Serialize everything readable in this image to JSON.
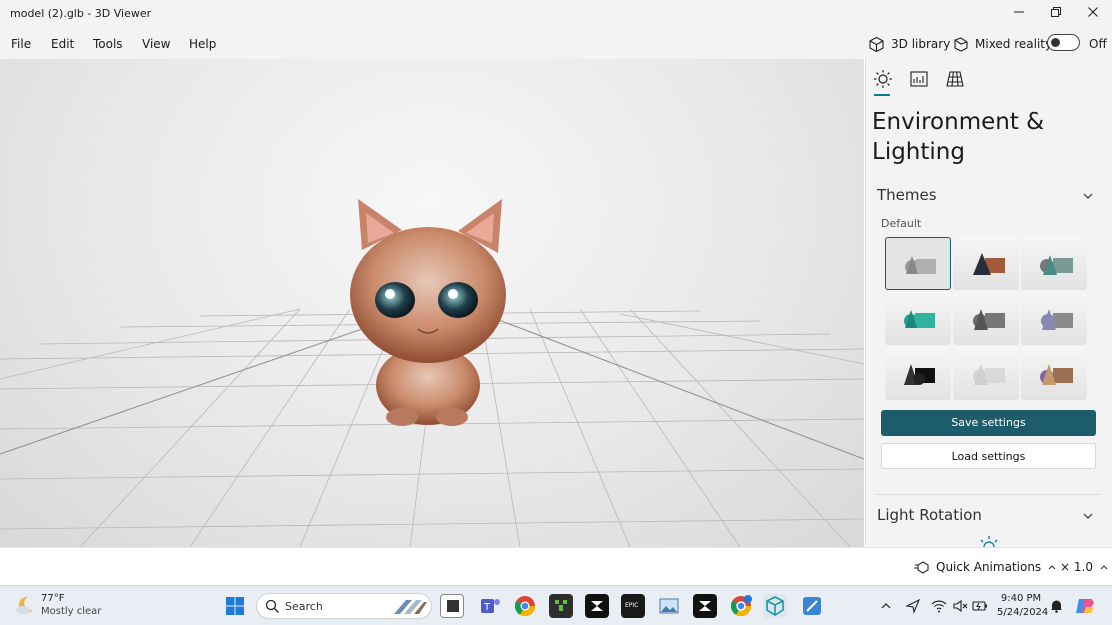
{
  "window": {
    "title": "model (2).glb - 3D Viewer"
  },
  "menu": {
    "file": "File",
    "edit": "Edit",
    "tools": "Tools",
    "view": "View",
    "help": "Help"
  },
  "toolbar": {
    "library": "3D library",
    "mixed_reality": "Mixed reality",
    "toggle_state": "Off"
  },
  "panel": {
    "title": "Environment & Lighting",
    "themes_header": "Themes",
    "default_label": "Default",
    "save_label": "Save settings",
    "load_label": "Load settings",
    "light_rotation": "Light Rotation",
    "accent": "#1c5c6b"
  },
  "status": {
    "quick_animations": "Quick Animations",
    "speed": "× 1.0"
  },
  "taskbar": {
    "weather_temp": "77°F",
    "weather_desc": "Mostly clear",
    "search_placeholder": "Search",
    "time": "9:40 PM",
    "date": "5/24/2024"
  }
}
